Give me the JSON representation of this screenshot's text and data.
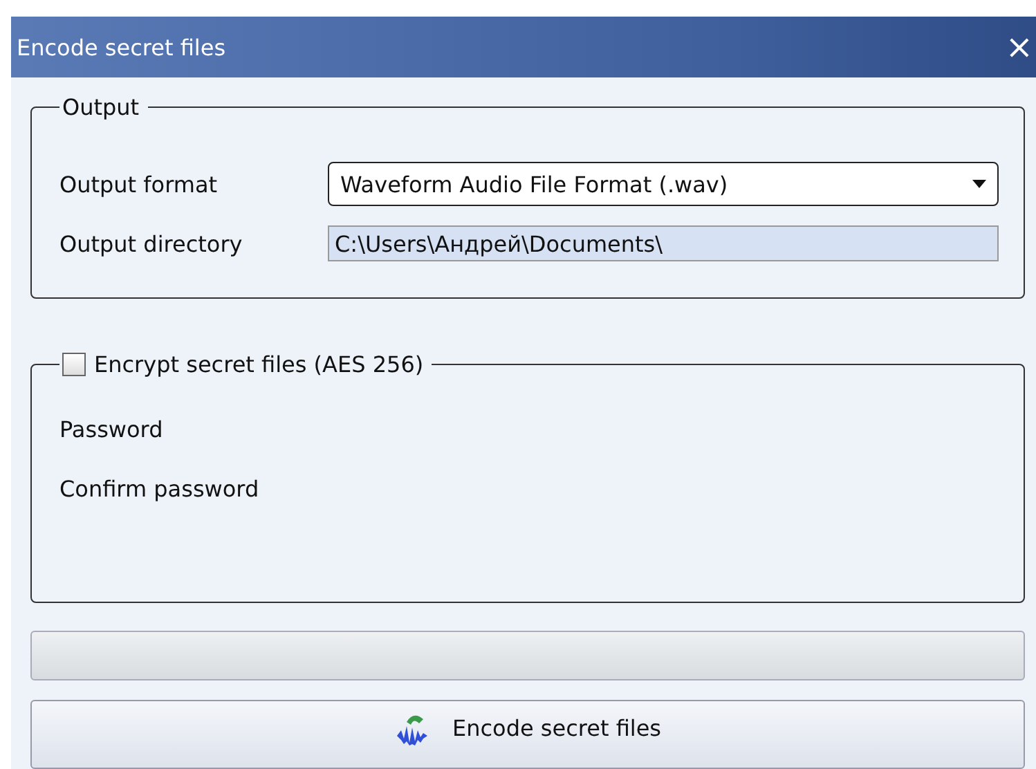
{
  "window": {
    "title": "Encode secret files",
    "close": "×"
  },
  "output": {
    "legend": "Output",
    "format": {
      "label": "Output format",
      "value": "Waveform Audio File Format (.wav)"
    },
    "directory": {
      "label": "Output directory",
      "value": "C:\\Users\\Андрей\\Documents\\"
    }
  },
  "encryption": {
    "legend": "Encrypt secret files (AES 256)",
    "checked": false,
    "password_label": "Password",
    "confirm_label": "Confirm password"
  },
  "progress": {
    "level": 0
  },
  "encode_button": {
    "label": "Encode secret files"
  }
}
